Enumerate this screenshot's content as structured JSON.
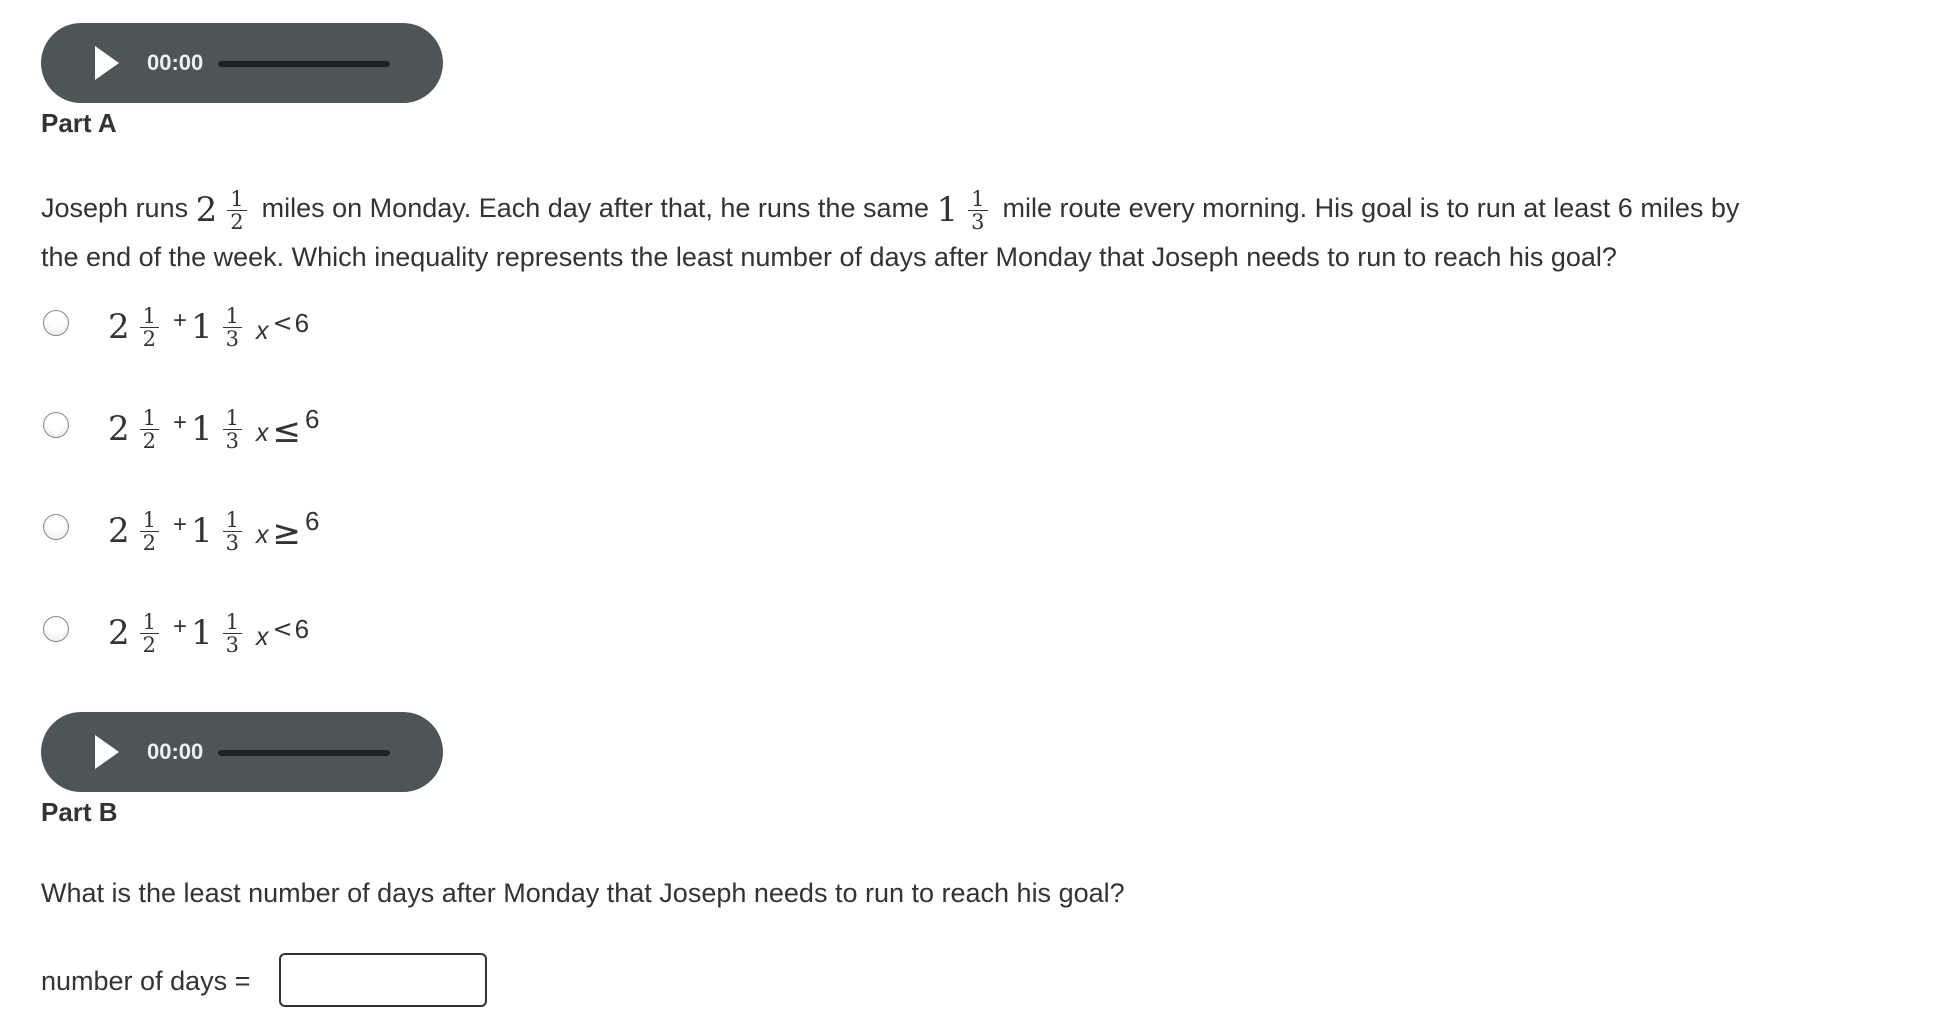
{
  "audio_players": [
    {
      "time": "00:00",
      "icon": "play-icon"
    },
    {
      "time": "00:00",
      "icon": "play-icon"
    }
  ],
  "part_a": {
    "label": "Part A",
    "question": {
      "seg1": "Joseph runs",
      "mixed1": {
        "whole": "2",
        "num": "1",
        "den": "2"
      },
      "seg2": "miles on Monday. Each day after that, he runs the same",
      "mixed2": {
        "whole": "1",
        "num": "1",
        "den": "3"
      },
      "seg3": "mile route every morning. His goal is to run at least 6 miles by",
      "line2": "the end of the week. Which inequality represents the least number of days after Monday that Joseph needs to run to reach his goal?"
    },
    "options": [
      {
        "a_whole": "2",
        "a_num": "1",
        "a_den": "2",
        "plus": "+",
        "b_whole": "1",
        "b_num": "1",
        "b_den": "3",
        "var": "x",
        "rel": "<",
        "rhs": "6"
      },
      {
        "a_whole": "2",
        "a_num": "1",
        "a_den": "2",
        "plus": "+",
        "b_whole": "1",
        "b_num": "1",
        "b_den": "3",
        "var": "x",
        "rel": "≤",
        "rhs": "6"
      },
      {
        "a_whole": "2",
        "a_num": "1",
        "a_den": "2",
        "plus": "+",
        "b_whole": "1",
        "b_num": "1",
        "b_den": "3",
        "var": "x",
        "rel": "≥",
        "rhs": "6"
      },
      {
        "a_whole": "2",
        "a_num": "1",
        "a_den": "2",
        "plus": "+",
        "b_whole": "1",
        "b_num": "1",
        "b_den": "3",
        "var": "x",
        "rel": "<",
        "rhs": "6"
      }
    ]
  },
  "part_b": {
    "label": "Part B",
    "question": "What is the least number of days after Monday that Joseph needs to run to reach his goal?",
    "answer_label": "number of days =",
    "answer_value": ""
  }
}
